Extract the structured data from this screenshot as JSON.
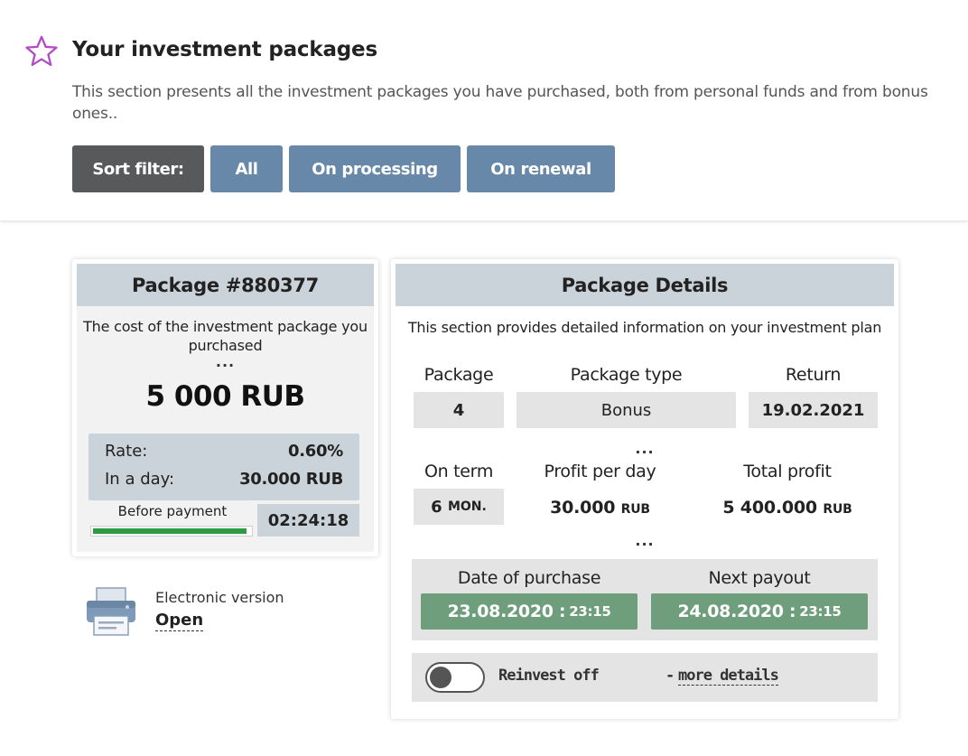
{
  "header": {
    "title": "Your investment packages",
    "description": "This section presents all the investment packages you have purchased, both from personal funds and from bonus ones..",
    "icon": "star-icon",
    "icon_color": "#b04cc4"
  },
  "filters": {
    "label": "Sort filter:",
    "options": [
      "All",
      "On processing",
      "On renewal"
    ]
  },
  "package": {
    "title": "Package #880377",
    "cost_label": "The cost of the investment package you purchased",
    "dots": "...",
    "amount": "5 000 RUB",
    "rate_label": "Rate:",
    "rate_value": "0.60%",
    "day_label": "In a day:",
    "day_value": "30.000 RUB",
    "before_payment_label": "Before payment",
    "before_payment_progress": 0.98,
    "timer": "02:24:18",
    "progress_color": "#2f9a45"
  },
  "electronic": {
    "label": "Electronic version",
    "link": "Open",
    "icon": "printer-icon"
  },
  "details": {
    "title": "Package Details",
    "description": "This section provides detailed information on your investment plan",
    "package_label": "Package",
    "package_value": "4",
    "type_label": "Package type",
    "type_value": "Bonus",
    "return_label": "Return",
    "return_value": "19.02.2021",
    "dots": "...",
    "term_label": "On term",
    "term_value": "6",
    "term_unit": "MON.",
    "profit_day_label": "Profit per day",
    "profit_day_value": "30.000",
    "profit_day_unit": "RUB",
    "total_profit_label": "Total profit",
    "total_profit_value": "5 400.000",
    "total_profit_unit": "RUB",
    "purchase_label": "Date of purchase",
    "purchase_date": "23.08.2020 :",
    "purchase_time": "23:15",
    "payout_label": "Next payout",
    "payout_date": "24.08.2020 :",
    "payout_time": "23:15",
    "reinvest_label": "Reinvest off",
    "more_dash": "-",
    "more_link": "more details",
    "reinvest_on": false,
    "date_color": "#6e9e7c"
  }
}
